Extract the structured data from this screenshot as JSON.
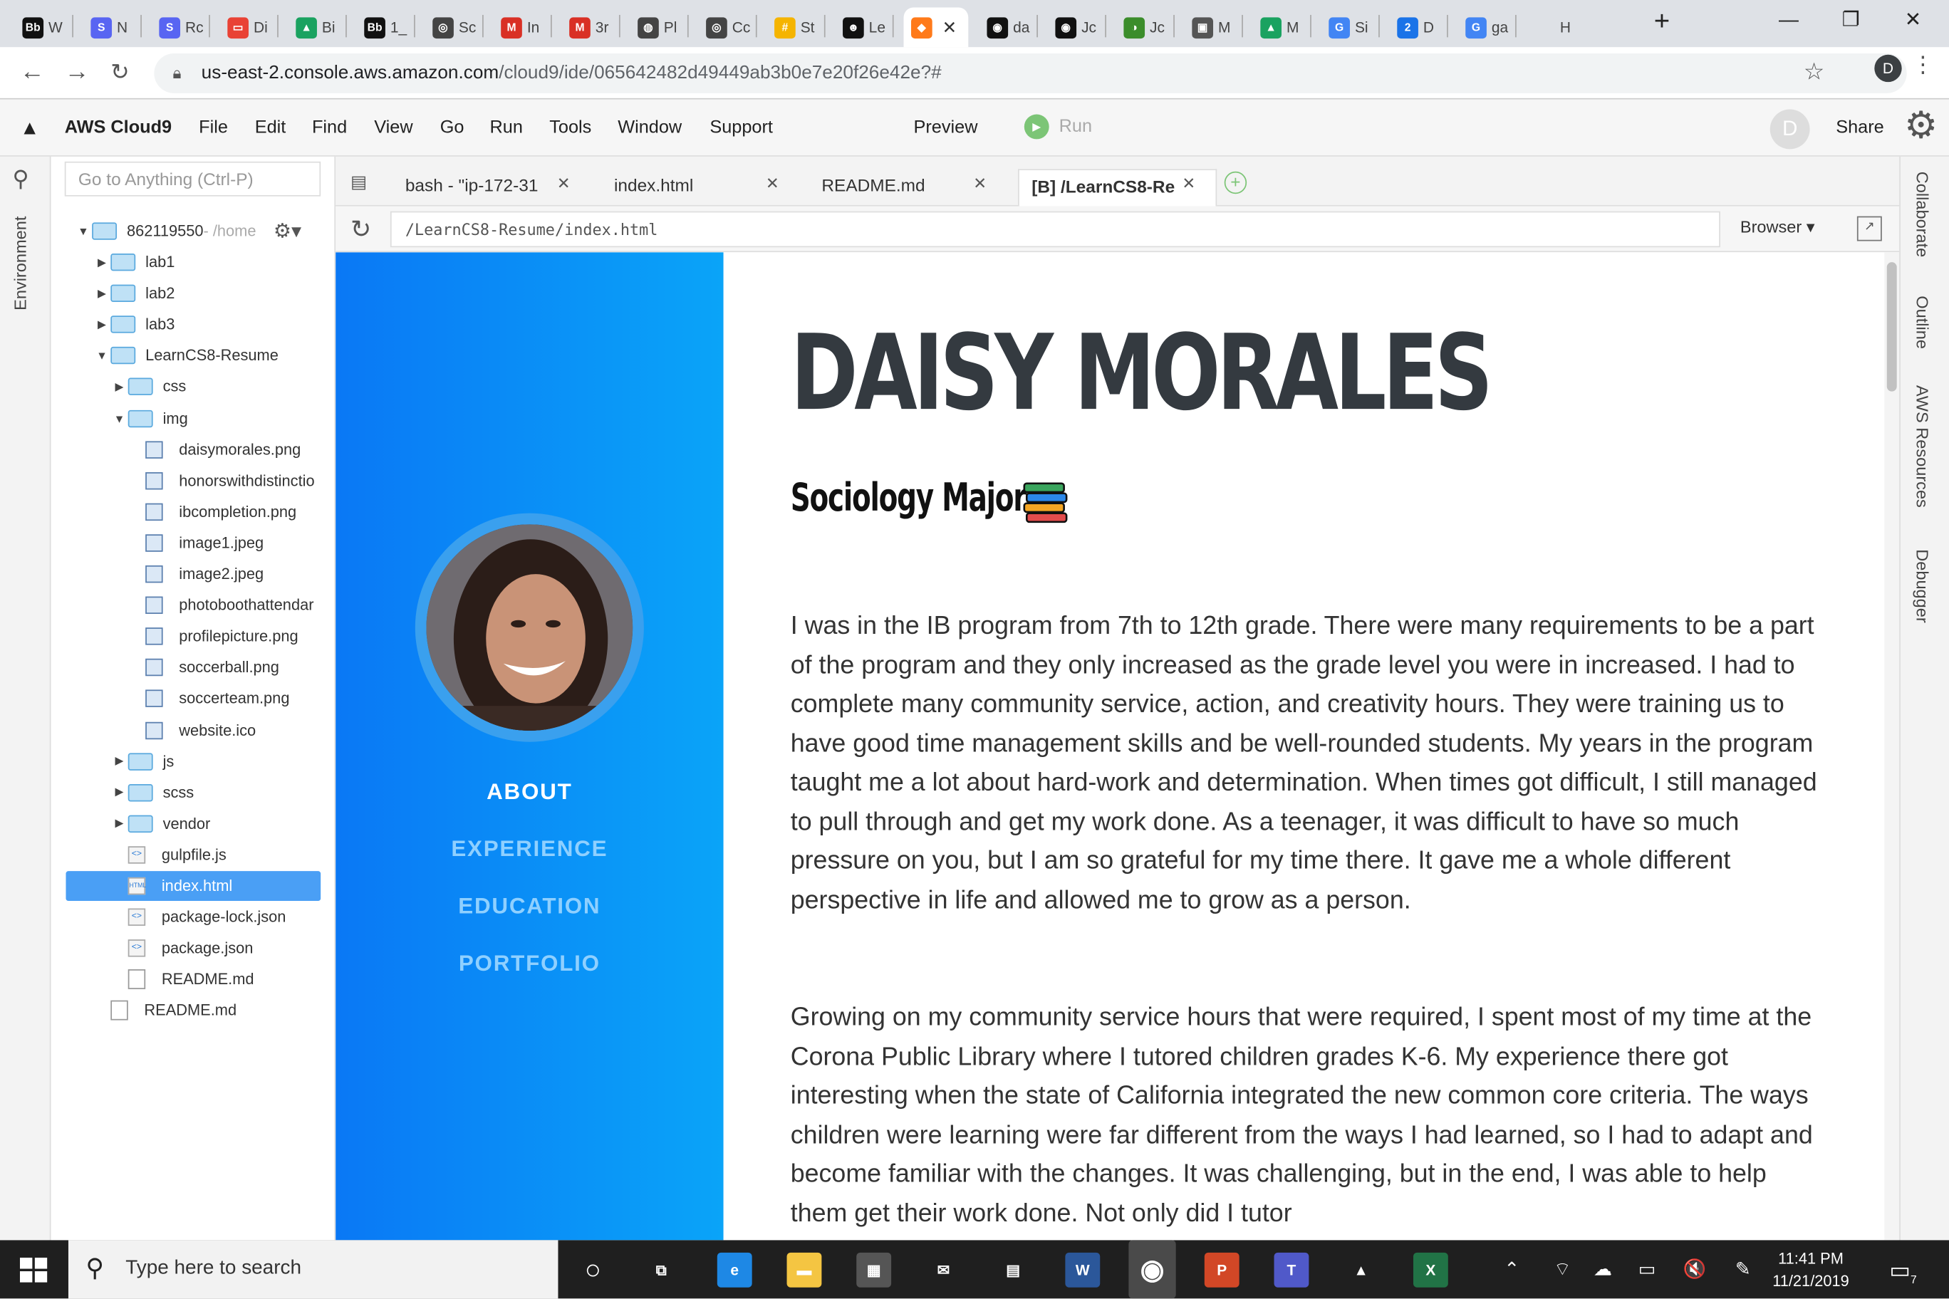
{
  "browser": {
    "tabs": [
      {
        "fav": "Bb",
        "label": "W",
        "color": "#111"
      },
      {
        "fav": "S",
        "label": "N",
        "color": "#5865f2"
      },
      {
        "fav": "S",
        "label": "Rc",
        "color": "#5865f2"
      },
      {
        "fav": "▭",
        "label": "Di",
        "color": "#e94235"
      },
      {
        "fav": "▲",
        "label": "Bi",
        "color": "#1aa260"
      },
      {
        "fav": "Bb",
        "label": "1_",
        "color": "#111"
      },
      {
        "fav": "◎",
        "label": "Sc",
        "color": "#444"
      },
      {
        "fav": "M",
        "label": "In",
        "color": "#d93025"
      },
      {
        "fav": "M",
        "label": "3r",
        "color": "#d93025"
      },
      {
        "fav": "◍",
        "label": "Pl",
        "color": "#444"
      },
      {
        "fav": "◎",
        "label": "Cc",
        "color": "#444"
      },
      {
        "fav": "#",
        "label": "St",
        "color": "#f5b400"
      },
      {
        "fav": "☻",
        "label": "Le",
        "color": "#111"
      },
      {
        "fav": "◆",
        "label": "",
        "color": "#ff7a1a",
        "active": true
      },
      {
        "fav": "◉",
        "label": "da",
        "color": "#111"
      },
      {
        "fav": "◉",
        "label": "Jc",
        "color": "#111"
      },
      {
        "fav": "◑",
        "label": "Jc",
        "color": "#3b8d2b"
      },
      {
        "fav": "▣",
        "label": "M",
        "color": "#555"
      },
      {
        "fav": "▲",
        "label": "M",
        "color": "#1aa260"
      },
      {
        "fav": "G",
        "label": "Si",
        "color": "#4285f4"
      },
      {
        "fav": "2",
        "label": "D",
        "color": "#1a73e8"
      },
      {
        "fav": "G",
        "label": "ga",
        "color": "#4285f4"
      },
      {
        "fav": "",
        "label": "H",
        "color": "#dee1e6"
      }
    ],
    "close_glyph": "✕",
    "new_tab": "+",
    "minimize": "—",
    "restore": "❐",
    "close_window": "✕",
    "url_host": "us-east-2.console.aws.amazon.com",
    "url_path": "/cloud9/ide/065642482d49449ab3b0e7e20f26e42e?#",
    "profile_initial": "D"
  },
  "ide": {
    "brand": "AWS Cloud9",
    "menu": [
      "File",
      "Edit",
      "Find",
      "View",
      "Go",
      "Run",
      "Tools",
      "Window",
      "Support"
    ],
    "preview_label": "Preview",
    "run_label": "Run",
    "avatar_initial": "D",
    "share_label": "Share",
    "environment_label": "Environment",
    "goto_placeholder": "Go to Anything (Ctrl-P)",
    "right_panels": [
      "Collaborate",
      "Outline",
      "AWS Resources",
      "Debugger"
    ],
    "tree": {
      "root_name": "862119550",
      "root_path": " - /home",
      "items": [
        {
          "label": "lab1",
          "type": "folder",
          "depth": 1,
          "arrow": "▶"
        },
        {
          "label": "lab2",
          "type": "folder",
          "depth": 1,
          "arrow": "▶"
        },
        {
          "label": "lab3",
          "type": "folder",
          "depth": 1,
          "arrow": "▶"
        },
        {
          "label": "LearnCS8-Resume",
          "type": "folder",
          "depth": 1,
          "arrow": "▼"
        },
        {
          "label": "css",
          "type": "folder",
          "depth": 2,
          "arrow": "▶"
        },
        {
          "label": "img",
          "type": "folder",
          "depth": 2,
          "arrow": "▼"
        },
        {
          "label": "daisymorales.png",
          "type": "image",
          "depth": 3
        },
        {
          "label": "honorswithdistinctio",
          "type": "image",
          "depth": 3
        },
        {
          "label": "ibcompletion.png",
          "type": "image",
          "depth": 3
        },
        {
          "label": "image1.jpeg",
          "type": "image",
          "depth": 3
        },
        {
          "label": "image2.jpeg",
          "type": "image",
          "depth": 3
        },
        {
          "label": "photoboothattendar",
          "type": "image",
          "depth": 3
        },
        {
          "label": "profilepicture.png",
          "type": "image",
          "depth": 3
        },
        {
          "label": "soccerball.png",
          "type": "image",
          "depth": 3
        },
        {
          "label": "soccerteam.png",
          "type": "image",
          "depth": 3
        },
        {
          "label": "website.ico",
          "type": "image",
          "depth": 3
        },
        {
          "label": "js",
          "type": "folder",
          "depth": 2,
          "arrow": "▶"
        },
        {
          "label": "scss",
          "type": "folder",
          "depth": 2,
          "arrow": "▶"
        },
        {
          "label": "vendor",
          "type": "folder",
          "depth": 2,
          "arrow": "▶"
        },
        {
          "label": "gulpfile.js",
          "type": "code",
          "depth": 2
        },
        {
          "label": "index.html",
          "type": "html",
          "depth": 2,
          "selected": true
        },
        {
          "label": "package-lock.json",
          "type": "code",
          "depth": 2
        },
        {
          "label": "package.json",
          "type": "code",
          "depth": 2
        },
        {
          "label": "README.md",
          "type": "doc",
          "depth": 2
        },
        {
          "label": "README.md",
          "type": "doc",
          "depth": 1
        }
      ]
    },
    "editor_tabs": [
      {
        "label": "bash - \"ip-172-31",
        "active": false
      },
      {
        "label": "index.html",
        "active": false
      },
      {
        "label": "README.md",
        "active": false
      },
      {
        "label": "[B] /LearnCS8-Re",
        "active": true
      }
    ],
    "preview_url": "/LearnCS8-Resume/index.html",
    "browser_select": "Browser ▾"
  },
  "resume": {
    "name": "DAISY MORALES",
    "subtitle": "Sociology Major",
    "nav": [
      {
        "label": "ABOUT",
        "active": true
      },
      {
        "label": "EXPERIENCE",
        "active": false
      },
      {
        "label": "EDUCATION",
        "active": false
      },
      {
        "label": "PORTFOLIO",
        "active": false
      }
    ],
    "paragraph1": "I was in the IB program from 7th to 12th grade. There were many requirements to be a part of the program and they only increased as the grade level you were in increased. I had to complete many community service, action, and creativity hours. They were training us to have good time management skills and be well-rounded students. My years in the program taught me a lot about hard-work and determination. When times got difficult, I still managed to pull through and get my work done. As a teenager, it was difficult to have so much pressure on you, but I am so grateful for my time there. It gave me a whole different perspective in life and allowed me to grow as a person.",
    "paragraph2": "Growing on my community service hours that were required, I spent most of my time at the Corona Public Library where I tutored children grades K-6. My experience there got interesting when the state of California integrated the new common core criteria. The ways children were learning were far different from the ways I had learned, so I had to adapt and become familiar with the changes. It was challenging, but in the end, I was able to help them get their work done. Not only did I tutor"
  },
  "taskbar": {
    "search_placeholder": "Type here to search",
    "time": "11:41 PM",
    "date": "11/21/2019",
    "notification_count": "7",
    "apps": [
      {
        "icon": "cortana-icon",
        "glyph": "○",
        "color": "transparent"
      },
      {
        "icon": "task-view-icon",
        "glyph": "⧉",
        "color": "transparent"
      },
      {
        "icon": "edge-icon",
        "glyph": "e",
        "color": "#1e88e5"
      },
      {
        "icon": "file-explorer-icon",
        "glyph": "▬",
        "color": "#f4c542"
      },
      {
        "icon": "store-icon",
        "glyph": "▦",
        "color": "#555"
      },
      {
        "icon": "mail-icon",
        "glyph": "✉",
        "color": "transparent"
      },
      {
        "icon": "movies-icon",
        "glyph": "▤",
        "color": "transparent"
      },
      {
        "icon": "word-icon",
        "glyph": "W",
        "color": "#2b579a"
      },
      {
        "icon": "chrome-icon",
        "glyph": "◉",
        "color": "#4a4a4a"
      },
      {
        "icon": "powerpoint-icon",
        "glyph": "P",
        "color": "#d24726"
      },
      {
        "icon": "teams-icon",
        "glyph": "T",
        "color": "#5059c9"
      },
      {
        "icon": "photos-icon",
        "glyph": "▲",
        "color": "transparent"
      },
      {
        "icon": "excel-icon",
        "glyph": "X",
        "color": "#217346"
      }
    ],
    "tray": [
      "⌃",
      "⌔",
      "☁",
      "▭",
      "🔇",
      "✎"
    ]
  }
}
